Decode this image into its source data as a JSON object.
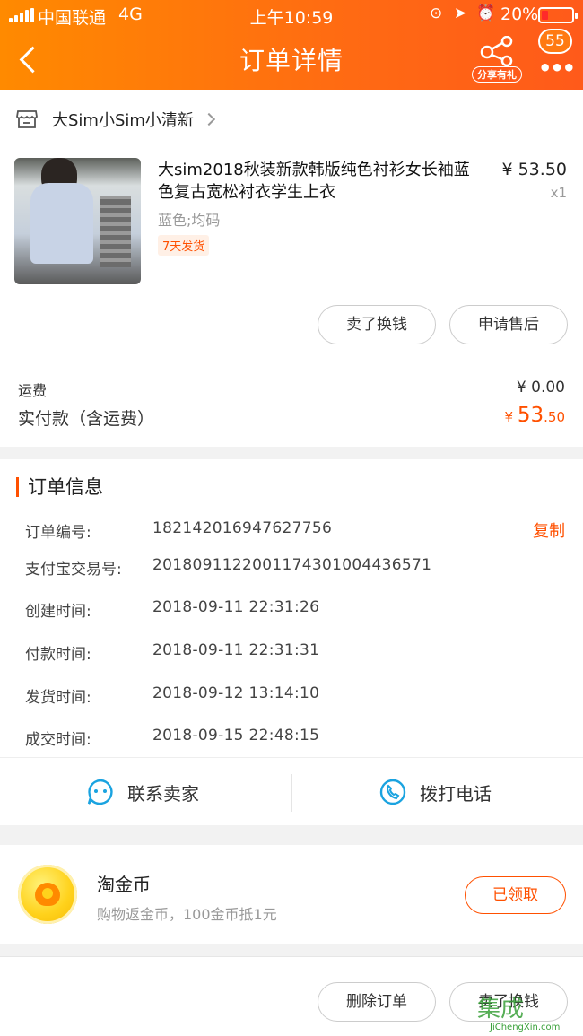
{
  "status_bar": {
    "carrier": "中国联通",
    "network": "4G",
    "time": "上午10:59",
    "battery": "20%"
  },
  "nav": {
    "title": "订单详情",
    "share_label": "分享有礼",
    "more_badge": "55"
  },
  "shop": {
    "name": "大Sim小Sim小清新"
  },
  "product": {
    "title": "大sim2018秋装新款韩版纯色衬衫女长袖蓝色复古宽松衬衣学生上衣",
    "spec": "蓝色;均码",
    "tag": "7天发货",
    "price": "¥ 53.50",
    "qty": "x1",
    "actions": [
      "卖了换钱",
      "申请售后"
    ]
  },
  "summary": {
    "shipping_label": "运费",
    "shipping_value": "¥ 0.00",
    "paid_label": "实付款（含运费）",
    "paid_currency": "¥ ",
    "paid_integer": "53",
    "paid_decimal": ".50"
  },
  "order_info": {
    "title": "订单信息",
    "copy_label": "复制",
    "rows": [
      {
        "label": "订单编号:",
        "value": "182142016947627756"
      },
      {
        "label": "支付宝交易号:",
        "value": "2018091122001174301004436571"
      },
      {
        "label": "创建时间:",
        "value": "2018-09-11 22:31:26"
      },
      {
        "label": "付款时间:",
        "value": "2018-09-11 22:31:31"
      },
      {
        "label": "发货时间:",
        "value": "2018-09-12 13:14:10"
      },
      {
        "label": "成交时间:",
        "value": "2018-09-15 22:48:15"
      }
    ],
    "contact_seller": "联系卖家",
    "call_phone": "拨打电话"
  },
  "coins": {
    "title": "淘金币",
    "subtitle": "购物返金币，100金币抵1元",
    "button": "已领取"
  },
  "footer": {
    "delete_order": "删除订单",
    "sell_again": "卖了换钱"
  },
  "watermark": {
    "text": "集成",
    "url": "JiChengXin.com"
  },
  "colors": {
    "brand_orange": "#ff5000",
    "header_gradient_start": "#ff8a00",
    "header_gradient_end": "#ff5a1a",
    "contact_icon_blue": "#1aa3e0"
  }
}
